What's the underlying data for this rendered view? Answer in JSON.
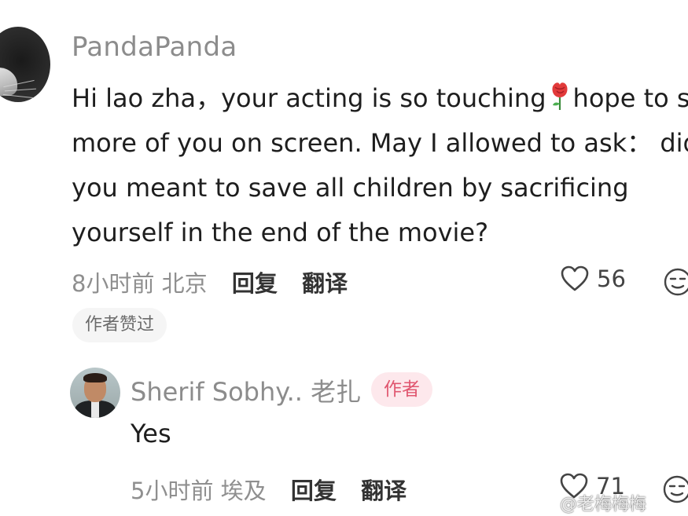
{
  "comment": {
    "username": "PandaPanda",
    "lines": [
      "Hi lao zha，your acting is so touching",
      "hope to see",
      "more of you on screen. May I allowed to ask： did",
      "you meant to save all children by sacrificing",
      "yourself in the end of the movie?"
    ],
    "time_location": "8小时前 北京",
    "reply_label": "回复",
    "translate_label": "翻译",
    "like_count": "56",
    "author_liked_badge": "作者赞过"
  },
  "reply": {
    "username": "Sherif Sobhy.. 老扎",
    "author_badge": "作者",
    "text": "Yes",
    "time_location": "5小时前 埃及",
    "reply_label": "回复",
    "translate_label": "翻译",
    "like_count": "71"
  },
  "watermark": "@老梅梅梅",
  "icons": {
    "avatar_main": "cat-avatar",
    "rose": "rose-emoji",
    "like": "heart-outline-icon",
    "emoji_reaction": "smiley-face-icon",
    "avatar_reply": "man-in-suit-avatar"
  },
  "colors": {
    "author_badge_bg": "#fde8ec",
    "author_badge_text": "#e0566f",
    "liked_badge_bg": "#f5f5f5",
    "muted_text": "#8c8c8c"
  }
}
